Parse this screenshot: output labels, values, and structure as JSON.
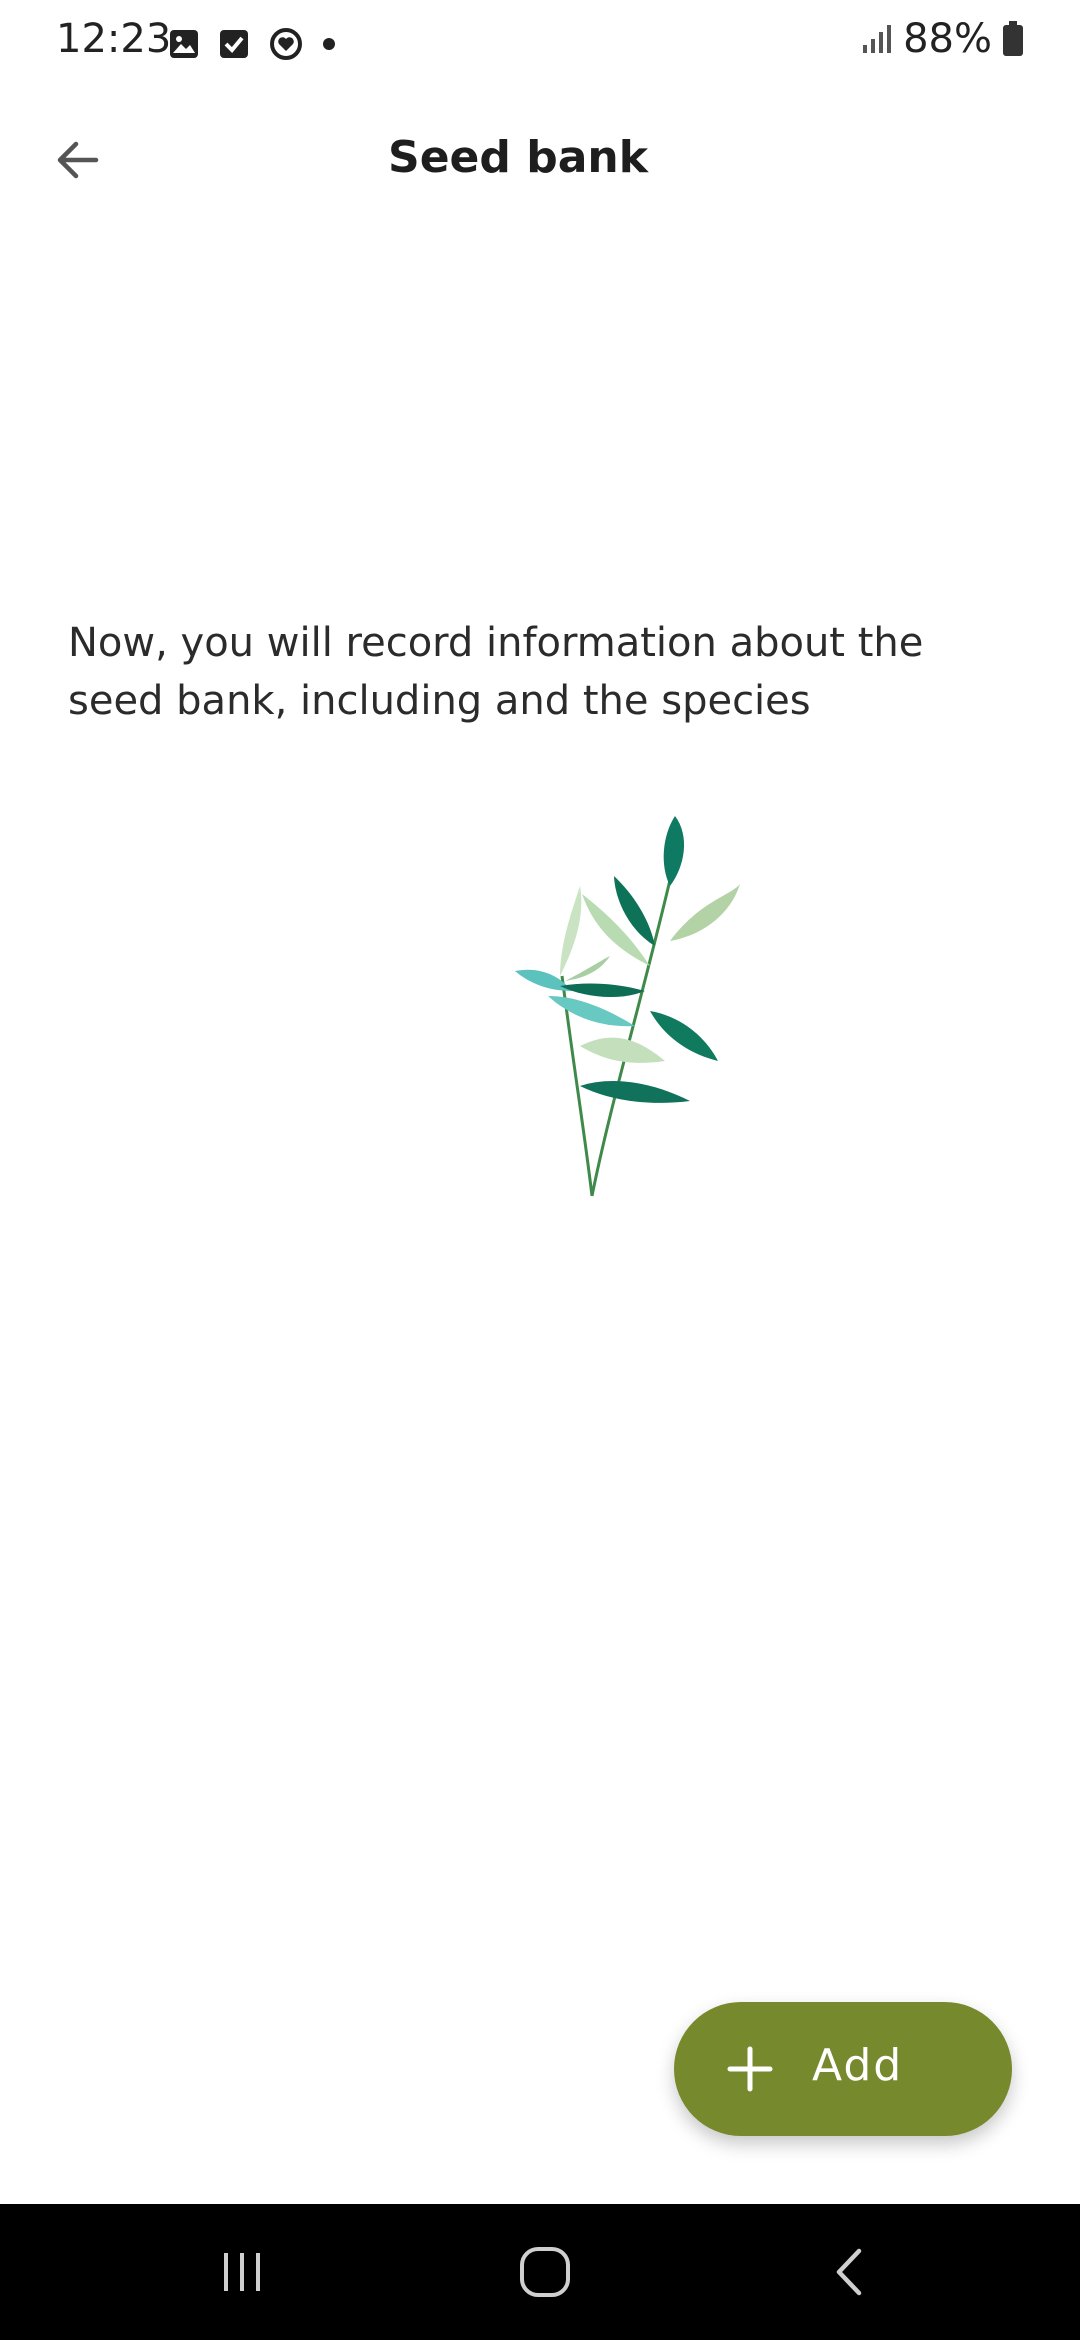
{
  "status_bar": {
    "time": "12:23",
    "battery": "88%",
    "icons": [
      "image-icon",
      "checkbox-icon",
      "heart-circle-icon",
      "dot-icon",
      "signal-icon",
      "battery-icon"
    ]
  },
  "app_bar": {
    "title": "Seed bank",
    "back_icon": "arrow-left-icon"
  },
  "main": {
    "intro_text": "Now, you will record information about the seed bank, including and the species",
    "illustration": "leafy-branch-illustration"
  },
  "fab": {
    "label": "Add",
    "icon": "plus-icon",
    "color": "#76892c"
  },
  "nav_bar": {
    "icons": [
      "recent-apps-icon",
      "home-icon",
      "back-icon"
    ]
  }
}
